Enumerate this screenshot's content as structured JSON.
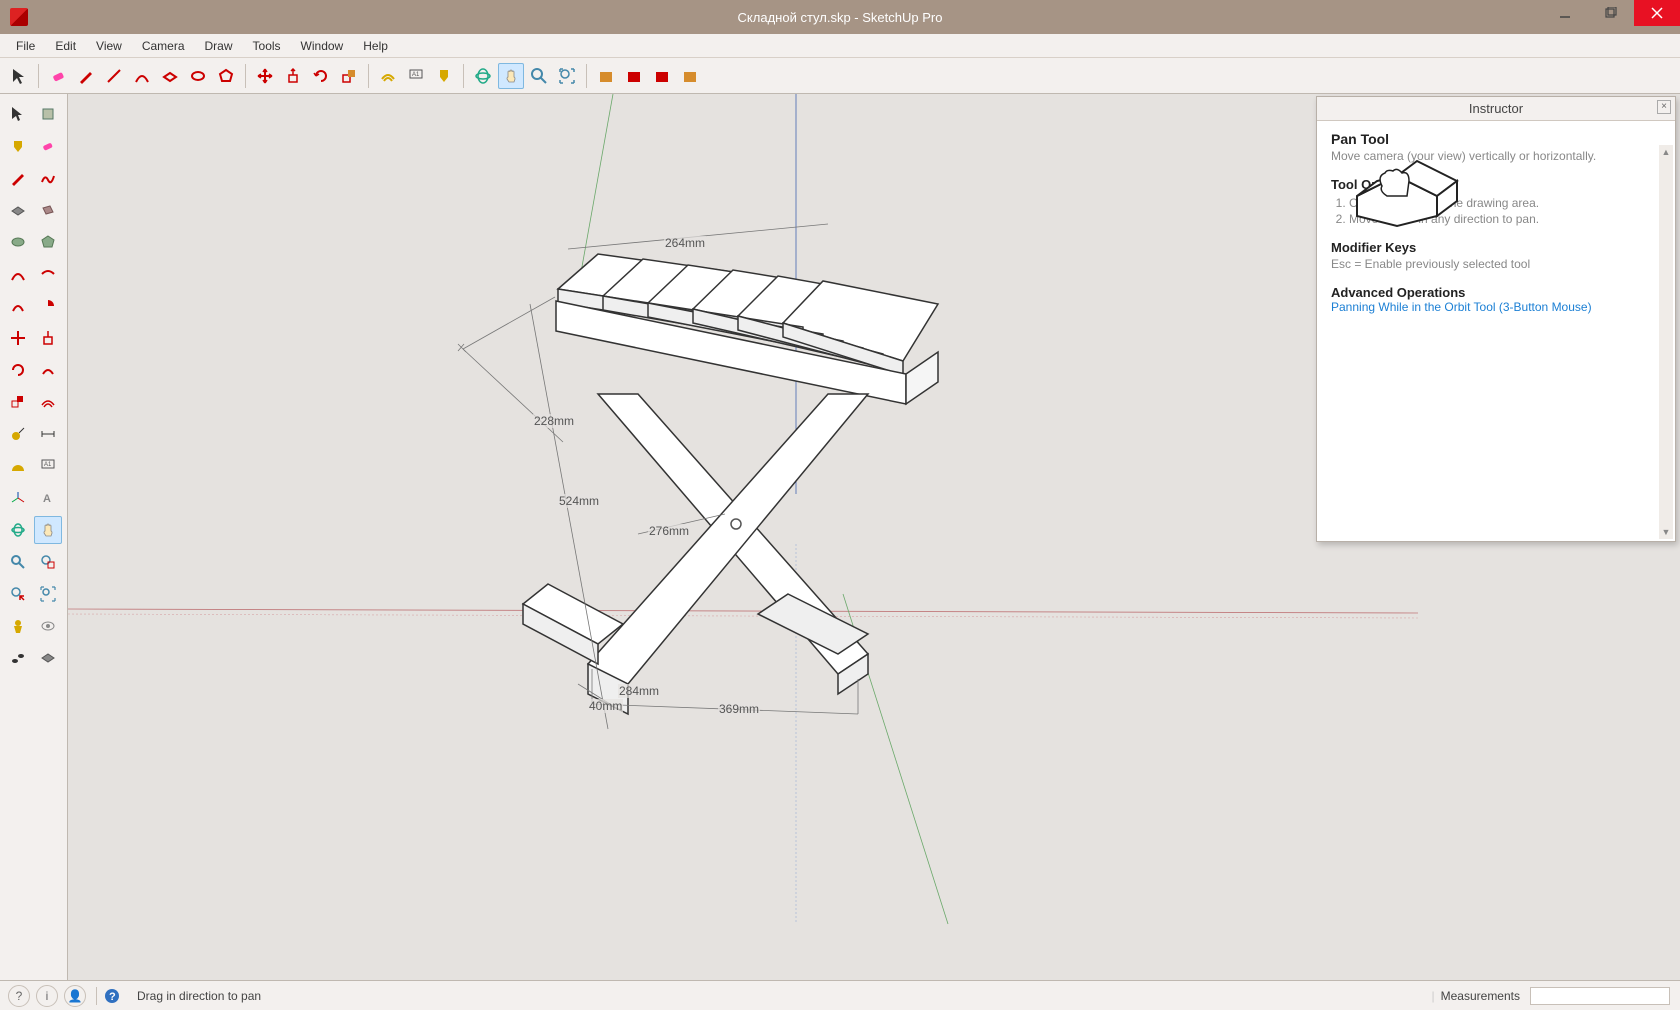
{
  "window": {
    "title": "Складной стул.skp - SketchUp Pro"
  },
  "menubar": [
    "File",
    "Edit",
    "View",
    "Camera",
    "Draw",
    "Tools",
    "Window",
    "Help"
  ],
  "toolbar_top": [
    {
      "name": "select",
      "color": "#333"
    },
    {
      "name": "eraser",
      "color": "#e07090"
    },
    {
      "name": "pencil",
      "color": "#c00"
    },
    {
      "name": "line",
      "color": "#c00"
    },
    {
      "name": "arc",
      "color": "#c00"
    },
    {
      "name": "rectangle",
      "color": "#c00"
    },
    {
      "name": "circle",
      "color": "#c00"
    },
    {
      "name": "polygon",
      "color": "#c00"
    },
    {
      "name": "pushpull",
      "color": "#c00"
    },
    {
      "name": "move",
      "color": "#c00"
    },
    {
      "name": "rotate",
      "color": "#c00"
    },
    {
      "name": "offset",
      "color": "#d68c2c"
    },
    {
      "name": "scale",
      "color": "#c00"
    },
    {
      "name": "tape",
      "color": "#d6a800"
    },
    {
      "name": "text",
      "color": "#333"
    },
    {
      "name": "paint",
      "color": "#d6a800"
    },
    {
      "name": "orbit",
      "color": "#2a8"
    },
    {
      "name": "pan",
      "color": "#48a",
      "active": true
    },
    {
      "name": "zoom",
      "color": "#48a"
    },
    {
      "name": "zoom-extents",
      "color": "#48a"
    },
    {
      "name": "get-models",
      "color": "#d68c2c"
    },
    {
      "name": "3d-warehouse",
      "color": "#c00"
    },
    {
      "name": "share",
      "color": "#c00"
    },
    {
      "name": "layout",
      "color": "#c00"
    }
  ],
  "toolbar_left": [
    [
      "select-arrow",
      "make-component"
    ],
    [
      "paint-bucket",
      "eraser"
    ],
    [
      "line",
      "freehand"
    ],
    [
      "rectangle",
      "rotated-rect"
    ],
    [
      "circle",
      "polygon"
    ],
    [
      "arc",
      "2point-arc"
    ],
    [
      "3point-arc",
      "pie"
    ],
    [
      "move",
      "pushpull"
    ],
    [
      "rotate",
      "follow-me"
    ],
    [
      "scale",
      "offset"
    ],
    [
      "tape-measure",
      "dimension"
    ],
    [
      "protractor",
      "text"
    ],
    [
      "axes",
      "3d-text"
    ],
    [
      "orbit",
      "pan"
    ],
    [
      "zoom",
      "zoom-window"
    ],
    [
      "previous",
      "zoom-extents"
    ],
    [
      "position-camera",
      "look-around"
    ],
    [
      "walk",
      "section-plane"
    ]
  ],
  "dimensions": {
    "d264": "264mm",
    "d228": "228mm",
    "d524": "524mm",
    "d276": "276mm",
    "d284": "284mm",
    "d40": "40mm",
    "d369": "369mm"
  },
  "instructor": {
    "title": "Instructor",
    "tool_name": "Pan Tool",
    "tool_desc": "Move camera (your view) vertically or horizontally.",
    "op_heading": "Tool Operation",
    "op1": "Click anywhere in the drawing area.",
    "op2": "Move cursor in any direction to pan.",
    "mk_heading": "Modifier Keys",
    "mk_text": "Esc = Enable previously selected tool",
    "adv_heading": "Advanced Operations",
    "adv_link": "Panning While in the Orbit Tool (3-Button Mouse)"
  },
  "statusbar": {
    "text": "Drag in direction to pan",
    "measurements_label": "Measurements"
  },
  "colors": {
    "accent": "#a69485",
    "close": "#e81123",
    "link": "#1b7fd4"
  }
}
